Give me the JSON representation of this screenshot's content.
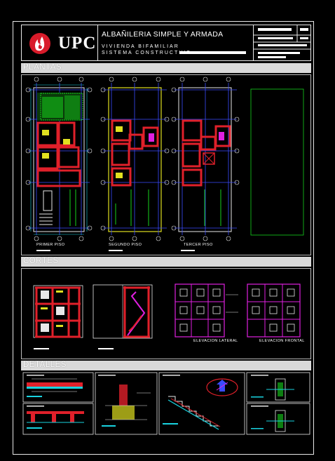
{
  "header": {
    "logo_text": "UPC",
    "title": "ALBAÑILERIA SIMPLE Y ARMADA",
    "subtitle_1": "VIVIENDA BIFAMILIAR",
    "subtitle_2": "SISTEMA CONSTRUCTIVO:"
  },
  "sections": {
    "plantas": "PLANTAS",
    "cortes": "CORTES",
    "detalles": "DETALLES"
  },
  "captions": {
    "primer_piso": "PRIMER PISO",
    "segundo_piso": "SEGUNDO PISO",
    "tercer_piso": "TERCER PISO",
    "elevacion_lateral": "ELEVACION LATERAL",
    "elevacion_frontal": "ELEVACION FRONTAL"
  },
  "colors": {
    "background": "#000000",
    "brand_red": "#d81b2a",
    "wall_red": "#e0202a",
    "axis_blue": "#3a4bff",
    "dim_cyan": "#19d3e0",
    "plant_green": "#16d21c",
    "elevation_magenta": "#e020e0",
    "section_bar": "#d9d9d9"
  },
  "icons": [
    "upc-flame-logo"
  ]
}
